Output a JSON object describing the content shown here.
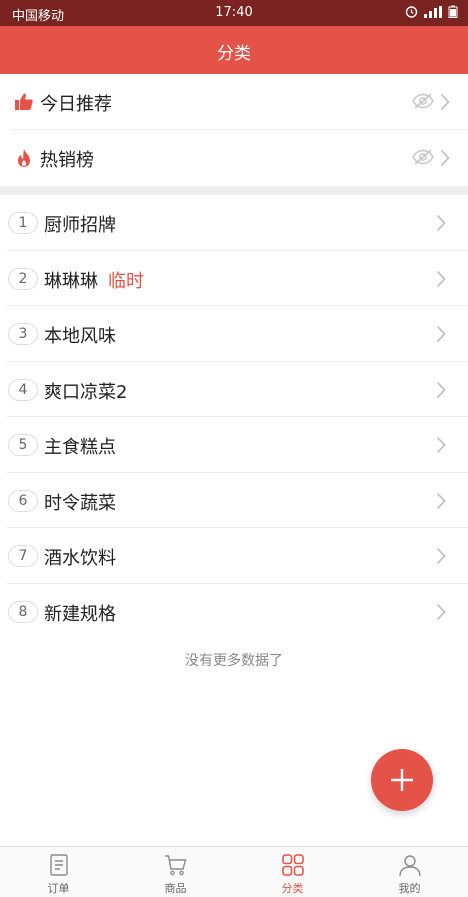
{
  "status_bar": {
    "carrier": "中国移动",
    "time": "17:40"
  },
  "header": {
    "title": "分类"
  },
  "fixed_items": [
    {
      "label": "今日推荐",
      "icon": "thumbs-up-icon"
    },
    {
      "label": "热销榜",
      "icon": "flame-icon"
    }
  ],
  "categories": [
    {
      "num": "1",
      "label": "厨师招牌",
      "tag": ""
    },
    {
      "num": "2",
      "label": "琳琳琳",
      "tag": "临时"
    },
    {
      "num": "3",
      "label": "本地风味",
      "tag": ""
    },
    {
      "num": "4",
      "label": "爽口凉菜2",
      "tag": ""
    },
    {
      "num": "5",
      "label": "主食糕点",
      "tag": ""
    },
    {
      "num": "6",
      "label": "时令蔬菜",
      "tag": ""
    },
    {
      "num": "7",
      "label": "酒水饮料",
      "tag": ""
    },
    {
      "num": "8",
      "label": "新建规格",
      "tag": ""
    }
  ],
  "list_footer": "没有更多数据了",
  "tabs": [
    {
      "label": "订单",
      "icon": "order-icon"
    },
    {
      "label": "商品",
      "icon": "cart-icon"
    },
    {
      "label": "分类",
      "icon": "category-grid-icon",
      "active": true
    },
    {
      "label": "我的",
      "icon": "profile-icon"
    }
  ],
  "colors": {
    "accent": "#e55247",
    "status_bar": "#7a2320"
  }
}
